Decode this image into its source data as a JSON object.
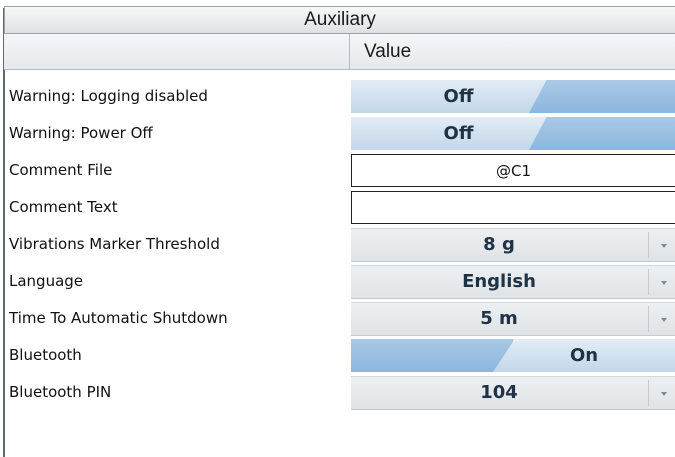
{
  "panel": {
    "title": "Auxiliary",
    "value_header": "Value"
  },
  "rows": [
    {
      "label": "Warning: Logging disabled",
      "type": "toggle",
      "value": "Off"
    },
    {
      "label": "Warning: Power Off",
      "type": "toggle",
      "value": "Off"
    },
    {
      "label": "Comment File",
      "type": "text",
      "value": "@C1"
    },
    {
      "label": "Comment Text",
      "type": "text",
      "value": ""
    },
    {
      "label": "Vibrations Marker Threshold",
      "type": "dropdown",
      "value": "8 g",
      "icon": "chevron-down-icon"
    },
    {
      "label": "Language",
      "type": "dropdown",
      "value": "English",
      "icon": "chevron-down-icon"
    },
    {
      "label": "Time To Automatic Shutdown",
      "type": "dropdown",
      "value": "5 m",
      "icon": "chevron-down-icon"
    },
    {
      "label": "Bluetooth",
      "type": "toggle",
      "value": "On"
    },
    {
      "label": "Bluetooth PIN",
      "type": "dropdown",
      "value": "104",
      "icon": "chevron-down-icon"
    }
  ],
  "colors": {
    "toggle_primary": "#c3d7ea",
    "toggle_secondary": "#8db6dd",
    "value_text": "#1f3246",
    "dropdown_bg": "#e6e9ec"
  }
}
